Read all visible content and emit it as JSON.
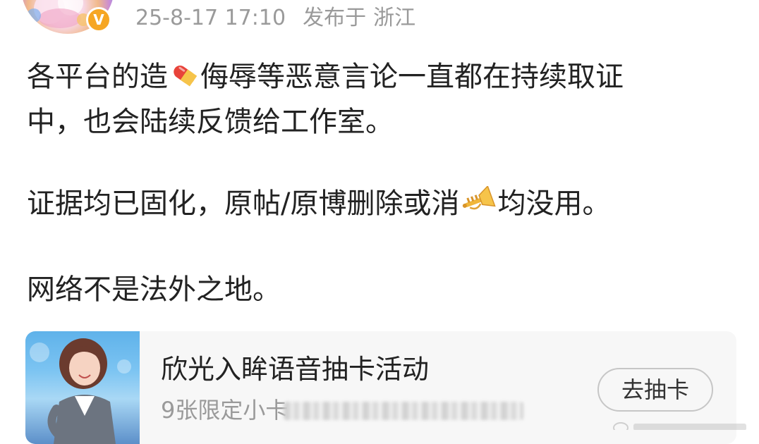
{
  "header": {
    "timestamp": "25-8-17 17:10",
    "location_prefix": "发布于",
    "location": "浙江",
    "verified_badge": "V",
    "avatar_icon": "avatar",
    "badge_icon": "verified-badge-icon",
    "badge_color": "#f6a623"
  },
  "post": {
    "p1_part1": "各平台的造",
    "p1_emoji_icon": "pill-icon",
    "p1_part2": "侮辱等恶意言论一直都在持续取证",
    "p1_line2": "中，也会陆续反馈给工作室。",
    "p2_part1": "证据均已固化，原帖/原博删除或消",
    "p2_emoji_icon": "trumpet-icon",
    "p2_part2": "均没用。",
    "p3": "网络不是法外之地。"
  },
  "card": {
    "thumbnail_icon": "idol-photo-thumbnail",
    "title": "欣光入眸语音抽卡活动",
    "subtitle": "9张限定小卡",
    "button_label": "去抽卡"
  },
  "colors": {
    "text_primary": "#222222",
    "text_secondary": "#9a9a9a",
    "card_background": "#f7f7f7",
    "button_border": "#c6c6c6"
  }
}
